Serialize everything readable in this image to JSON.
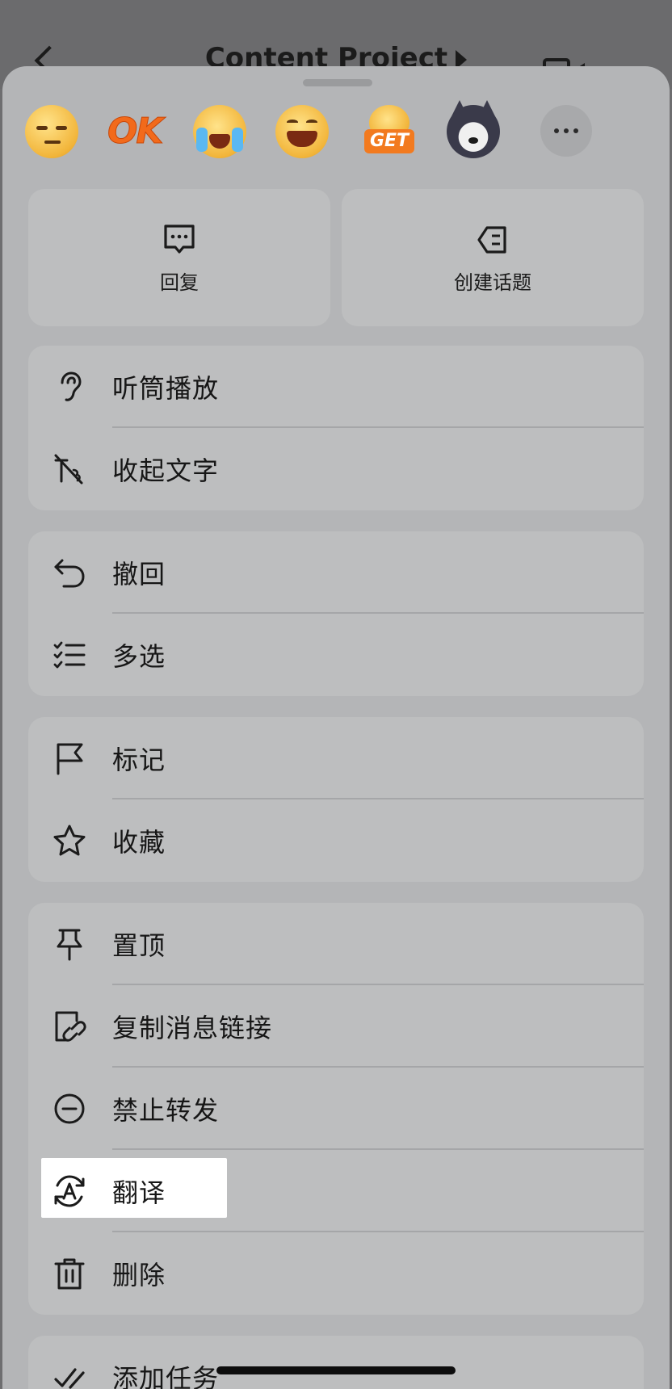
{
  "background": {
    "title": "Content Project"
  },
  "emoji_bar": {
    "items": [
      "smirk-emoji",
      "ok-emoji",
      "facepalm-cry-emoji",
      "laugh-cry-emoji",
      "get-emoji",
      "husky-dog-emoji"
    ],
    "ok_text": "OK",
    "get_text": "GET"
  },
  "quick_actions": {
    "reply": "回复",
    "create_topic": "创建话题"
  },
  "menu": {
    "group1": [
      {
        "label": "听筒播放",
        "icon": "ear-icon"
      },
      {
        "label": "收起文字",
        "icon": "hide-text-icon"
      }
    ],
    "group2": [
      {
        "label": "撤回",
        "icon": "undo-icon"
      },
      {
        "label": "多选",
        "icon": "multi-select-icon"
      }
    ],
    "group3": [
      {
        "label": "标记",
        "icon": "flag-icon"
      },
      {
        "label": "收藏",
        "icon": "star-icon"
      }
    ],
    "group4": [
      {
        "label": "置顶",
        "icon": "pin-icon"
      },
      {
        "label": "复制消息链接",
        "icon": "link-copy-icon"
      },
      {
        "label": "禁止转发",
        "icon": "no-forward-icon"
      },
      {
        "label": "翻译",
        "icon": "translate-icon"
      },
      {
        "label": "删除",
        "icon": "trash-icon"
      }
    ],
    "group5": [
      {
        "label": "添加任务",
        "icon": "add-task-icon"
      }
    ]
  },
  "colors": {
    "sheet": "#b4b5b7",
    "card": "#bdbebf",
    "highlight": "#ffffff"
  }
}
